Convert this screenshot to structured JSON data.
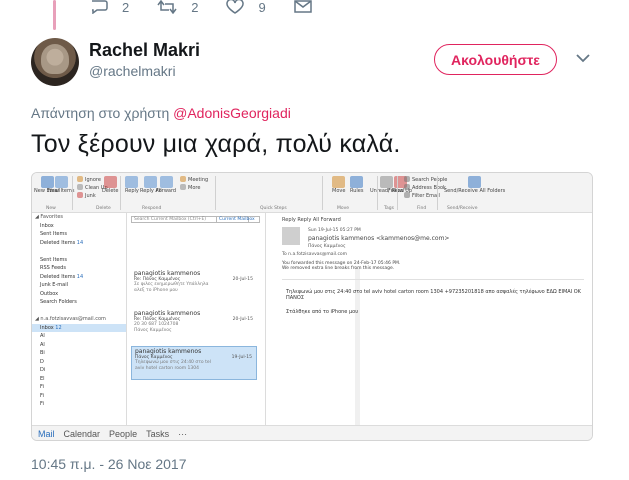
{
  "actions": {
    "replies": "2",
    "retweets": "2",
    "likes": "9"
  },
  "user": {
    "name": "Rachel Makri",
    "handle": "@rachelmakri",
    "follow_label": "Ακολουθήστε"
  },
  "reply": {
    "prefix": "Απάντηση στο χρήστη ",
    "mention": "@AdonisGeorgiadi"
  },
  "tweet": {
    "text": "Τον ξέρουν μια χαρά, πολύ καλά.",
    "timestamp": "10:45 π.μ. - 26 Νοε 2017"
  },
  "screenshot": {
    "ribbon_buttons": [
      "New Email",
      "New Items",
      "Ignore",
      "Clean Up",
      "Junk",
      "Delete",
      "Reply",
      "Reply All",
      "Forward",
      "Meeting",
      "More",
      "Move",
      "Rules",
      "Unread/ Read",
      "Follow Up",
      "Search People",
      "Address Book",
      "Filter Email",
      "Send/Receive All Folders"
    ],
    "ribbon_groups": [
      "New",
      "Delete",
      "Respond",
      "Quick Steps",
      "Move",
      "Tags",
      "Find",
      "Send/Receive"
    ],
    "folders": [
      {
        "label": "Favorites",
        "hdr": true
      },
      {
        "label": "Inbox"
      },
      {
        "label": "Sent Items"
      },
      {
        "label": "Deleted Items",
        "count": "14"
      },
      {
        "label": ""
      },
      {
        "label": "Sent Items"
      },
      {
        "label": "RSS Feeds"
      },
      {
        "label": "Deleted Items",
        "count": "14"
      },
      {
        "label": "Junk E-mail"
      },
      {
        "label": "Outbox"
      },
      {
        "label": "Search Folders"
      },
      {
        "label": ""
      },
      {
        "label": "n.a.fotzisavvas@mail.com",
        "hdr": true
      },
      {
        "label": "Inbox",
        "count": "12",
        "sel": true
      },
      {
        "label": "Al"
      },
      {
        "label": "Al"
      },
      {
        "label": "Bi"
      },
      {
        "label": "D"
      },
      {
        "label": "Di"
      },
      {
        "label": "El"
      },
      {
        "label": "Fi"
      },
      {
        "label": "Fi"
      },
      {
        "label": "Fi"
      }
    ],
    "search_placeholder": "Search Current Mailbox (Ctrl+E)",
    "mailbox_label": "Current Mailbox",
    "messages": [
      {
        "from": "panagiotis kammenos",
        "subject": "Re: Πάνος Καμμένος",
        "date": "20-Jul-15",
        "preview": "Σε φιλες ενημερωθήτε  Υπάλληλα",
        "preview2": "αλεξ το iPhone μου"
      },
      {
        "from": "panagiotis kammenos",
        "subject": "Re: Πάνος Καμμένος",
        "date": "20-Jul-15",
        "preview": "20 30 687 1024708",
        "preview2": "Πάνος Καμμένος"
      },
      {
        "from": "panagiotis kammenos",
        "subject": "Πάνος Καμμένος",
        "date": "19-Jul-15",
        "preview": "Τηλεφωνώ μου στις 24:40 στο tel",
        "preview2": "aviv hotel carton room 1304"
      }
    ],
    "reading": {
      "actions": "Reply   Reply All   Forward",
      "date": "Sun 19-Jul-15 05:27 PM",
      "from": "panagiotis kammenos <kammenos@me.com>",
      "subject": "Πάνος Καμμένος",
      "to": "To   n.a.fotzisavvas@mail.com",
      "info1": "You forwarded this message on 24-Feb-17 05:46 PM.",
      "info2": "We removed extra line breaks from this message.",
      "body1": "Τηλεφωνώ μου στις 24:40 στο tel aviv hotel carton room 1304 +97235201818 απο ασφαλές τηλέφωνο ΕΔΩ ΕΙΜΑΙ ΟΚ",
      "body2": "ΠΑΝΟΣ",
      "body3": "Στάλθηκε από το iPhone μου"
    },
    "nav": [
      "Mail",
      "Calendar",
      "People",
      "Tasks",
      "···"
    ]
  }
}
